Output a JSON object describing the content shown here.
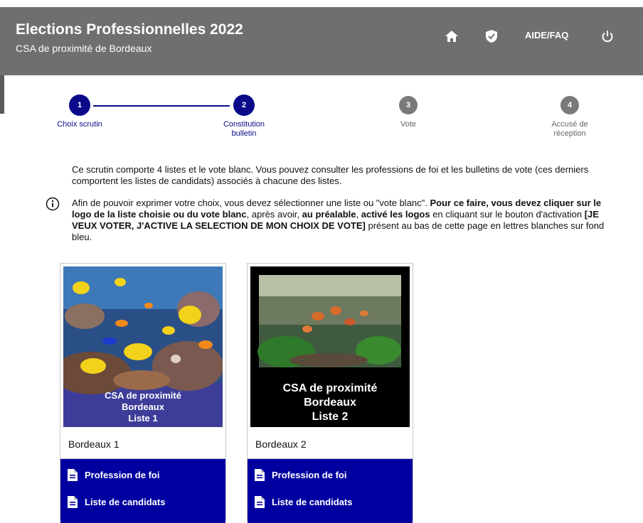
{
  "header": {
    "title": "Elections Professionnelles 2022",
    "subtitle": "CSA de proximité de Bordeaux",
    "aide_label": "AIDE/FAQ",
    "icons": [
      "home-icon",
      "shield-check-icon",
      "power-icon"
    ],
    "background": "#6f6f6f"
  },
  "stepper": {
    "steps": [
      {
        "number": "1",
        "label": "Choix scrutin",
        "state": "active"
      },
      {
        "number": "2",
        "label_line1": "Constitution",
        "label_line2": "bulletin",
        "state": "current"
      },
      {
        "number": "3",
        "label": "Vote",
        "state": "inactive"
      },
      {
        "number": "4",
        "label_line1": "Accusé de",
        "label_line2": "réception",
        "state": "inactive"
      }
    ],
    "active_color": "#0a0a8a"
  },
  "intro": {
    "line1": "Ce scrutin comporte 4 listes et le vote blanc. Vous pouvez consulter les professions de foi et les bulletins de vote",
    "line2": "(ces derniers comportent les listes de candidats) associés à chacune des listes."
  },
  "info": {
    "part1": "Afin de pouvoir exprimer votre choix, vous devez sélectionner une liste ou \"vote blanc\". ",
    "part2_bold": "Pour ce faire, vous devez cliquer sur le logo de la liste choisie ou du vote blanc",
    "part3": ", après avoir, ",
    "part4_bold": "au préalable",
    "part5": ", ",
    "part6_bold": "activé les logos",
    "part7": " en cliquant sur le bouton d'activation ",
    "part8_bold": "[JE VEUX VOTER, J'ACTIVE LA SELECTION DE MON CHOIX DE VOTE]",
    "part9": " présent au bas de cette page en lettres blanches sur fond bleu."
  },
  "cards": [
    {
      "logo_line1": "CSA de proximité",
      "logo_line2": "Bordeaux",
      "logo_line3": "Liste 1",
      "name": "Bordeaux 1",
      "profession_label": "Profession de foi",
      "candidats_label": "Liste de candidats"
    },
    {
      "logo_line1": "CSA de proximité",
      "logo_line2": "Bordeaux",
      "logo_line3": "Liste 2",
      "name": "Bordeaux 2",
      "profession_label": "Profession de foi",
      "candidats_label": "Liste de candidats"
    }
  ],
  "colors": {
    "action_blue": "#0000a0",
    "card1_logo_bg": "#3d3d99",
    "card2_logo_bg": "#000000"
  }
}
